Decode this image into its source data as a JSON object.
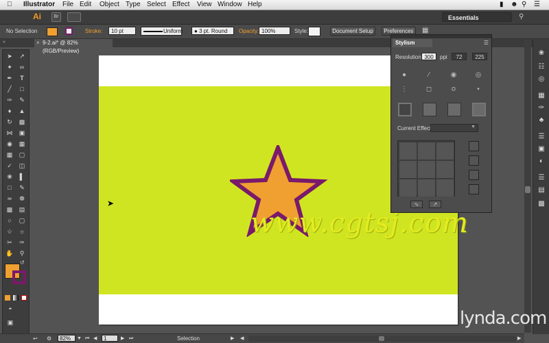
{
  "menubar": {
    "apple": "",
    "app": "Illustrator",
    "items": [
      "File",
      "Edit",
      "Object",
      "Type",
      "Select",
      "Effect",
      "View",
      "Window",
      "Help"
    ]
  },
  "appbar": {
    "logo": "Ai",
    "bridge": "Br",
    "workspace": "Essentials"
  },
  "control": {
    "selection": "No Selection",
    "stroke_label": "Stroke:",
    "stroke_value": "10 pt",
    "uniform": "Uniform",
    "brush": "3 pt. Round",
    "opacity_label": "Opacity:",
    "opacity_value": "100%",
    "style_label": "Style:",
    "doc_setup": "Document Setup",
    "preferences": "Preferences"
  },
  "doc_tab": "9-2.ai* @ 82% (RGB/Preview)",
  "artwork": {
    "watermark": "www.cgtsj.com",
    "bg_color": "#d0e521",
    "star_fill": "#f0a030",
    "star_stroke": "#7a1a6b"
  },
  "stylism": {
    "title": "Stylism",
    "resolution_label": "Resolution:",
    "resolution_value": "300",
    "ppi": "ppi",
    "res_72": "72",
    "res_225": "225",
    "current_effect_label": "Current Effect:"
  },
  "status": {
    "zoom": "82%",
    "page": "1",
    "tool": "Selection"
  },
  "branding": "lynda.com"
}
